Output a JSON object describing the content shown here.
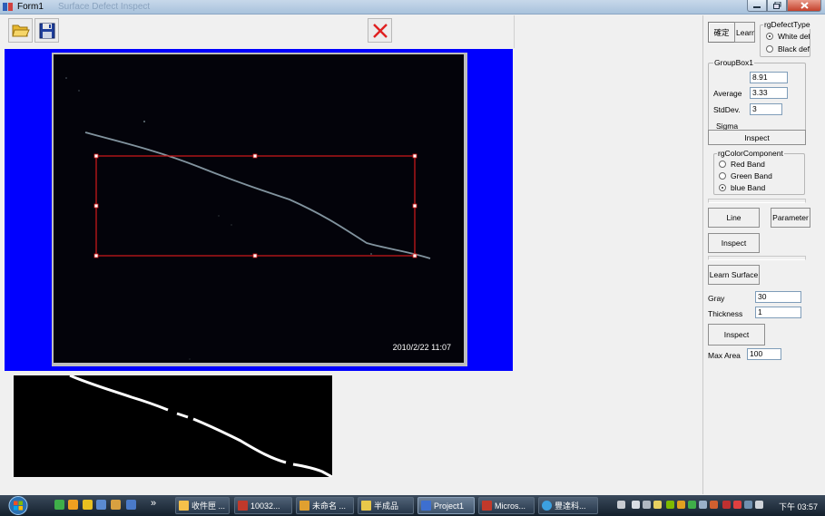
{
  "window": {
    "title": "Form1",
    "ghost_title": "Surface Defect Inspect"
  },
  "toolbar": {
    "open": "open-folder-icon",
    "save": "floppy-disk-icon",
    "cancel": "red-x-icon"
  },
  "camera": {
    "timestamp": "2010/2/22 11:07"
  },
  "right": {
    "confirm_label": "確定",
    "learn_label": "Learn",
    "defect_type": {
      "legend": "rgDefectType",
      "options": [
        "White defe",
        "Black defe"
      ],
      "selected": 0
    },
    "groupbox1": {
      "legend": "GroupBox1",
      "average_label": "Average",
      "average_value": "8.91",
      "stddev_label": "StdDev.",
      "stddev_value": "3.33",
      "sigma_label": "Sigma",
      "sigma_value": "3"
    },
    "inspect1_label": "Inspect",
    "color_component": {
      "legend": "rgColorComponent",
      "options": [
        "Red Band",
        "Green Band",
        "blue Band"
      ],
      "selected": 2
    },
    "line_label": "Line",
    "parameter_label": "Parameter",
    "inspect2_label": "Inspect",
    "learn_surface_label": "Learn Surface",
    "gray_label": "Gray",
    "gray_value": "30",
    "thickness_label": "Thickness",
    "thickness_value": "1",
    "inspect3_label": "Inspect",
    "max_area_label": "Max Area",
    "max_area_value": "100"
  },
  "taskbar": {
    "tasks": [
      {
        "label": "收件匣 ...",
        "color": "#f5c04a",
        "active": false
      },
      {
        "label": "10032...",
        "color": "#c0392b",
        "active": false
      },
      {
        "label": "未命名 ...",
        "color": "#e0a030",
        "active": false
      },
      {
        "label": "半成品",
        "color": "#e8c84a",
        "active": false
      },
      {
        "label": "Project1",
        "color": "#3d6fd0",
        "active": true
      },
      {
        "label": "Micros...",
        "color": "#c0392b",
        "active": false
      },
      {
        "label": "豐達科...",
        "color": "#3ca0e0",
        "active": false
      }
    ],
    "clock": "下午 03:57",
    "overflow": "»"
  }
}
